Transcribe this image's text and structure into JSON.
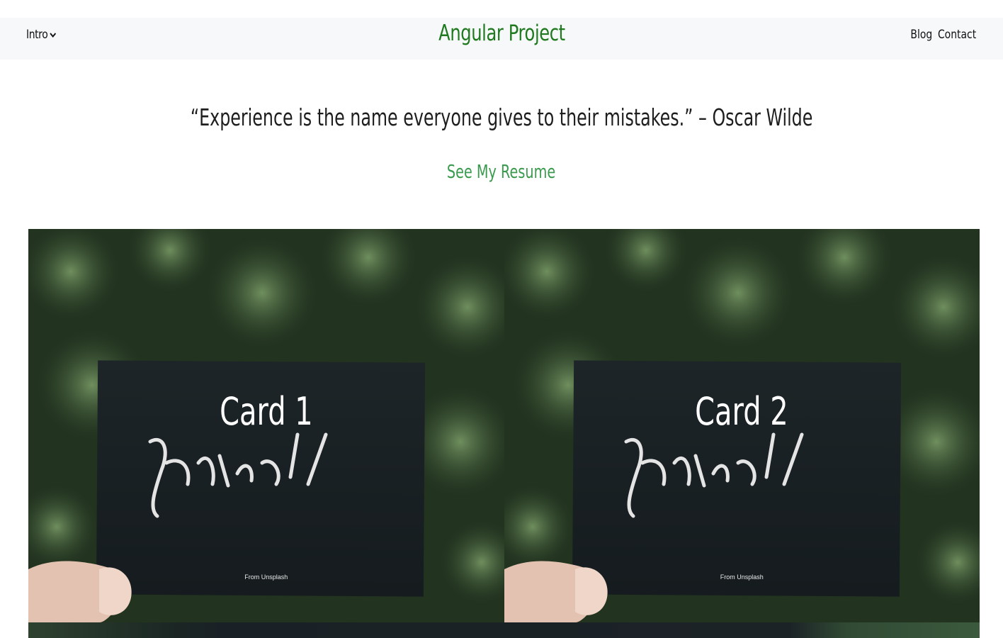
{
  "navbar": {
    "dropdown_label": "Intro",
    "brand": "Angular Project",
    "links": [
      "Blog",
      "Contact"
    ]
  },
  "hero": {
    "quote": "“Experience is the name everyone gives to their mistakes.” – Oscar Wilde",
    "resume_link": "See My Resume"
  },
  "cards": [
    {
      "title": "Card 1",
      "script_text": "Thanks!",
      "credit": "From Unsplash"
    },
    {
      "title": "Card 2",
      "script_text": "Thanks!",
      "credit": "From Unsplash"
    }
  ],
  "colors": {
    "brand": "#1f7a1f",
    "link_green": "#3a9a4e",
    "navbar_bg": "#f7f8f9"
  },
  "icons": {
    "dropdown": "chevron-down-icon"
  }
}
